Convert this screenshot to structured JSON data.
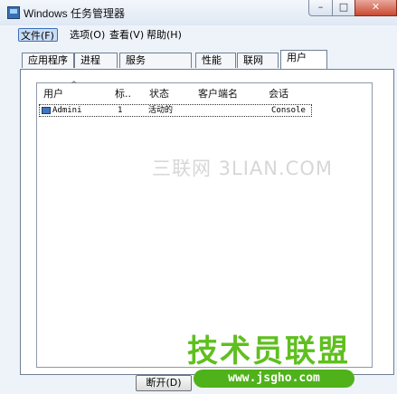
{
  "window": {
    "title": "Windows 任务管理器",
    "minimize": "–",
    "maximize": "□",
    "close": "✕"
  },
  "menu": [
    {
      "label": "文件(F)"
    },
    {
      "label": "选项(O)"
    },
    {
      "label": "查看(V)"
    },
    {
      "label": "帮助(H)"
    }
  ],
  "tabs": [
    {
      "label": "应用程序"
    },
    {
      "label": "进程"
    },
    {
      "label": "服务"
    },
    {
      "label": "性能"
    },
    {
      "label": "联网"
    },
    {
      "label": "用户",
      "active": true
    }
  ],
  "users_list": {
    "columns": [
      "用户",
      "标..",
      "状态",
      "客户端名",
      "会话"
    ],
    "sort_indicator": "^",
    "rows": [
      {
        "user": "Admini",
        "id": "1",
        "status": "活动的",
        "client": "",
        "session": "Console"
      }
    ]
  },
  "buttons": {
    "disconnect": "断开(D)"
  },
  "watermarks": {
    "site1": "三联网 3LIAN.COM",
    "site2": "技术员联盟",
    "site3": "www.jsgho.com"
  }
}
